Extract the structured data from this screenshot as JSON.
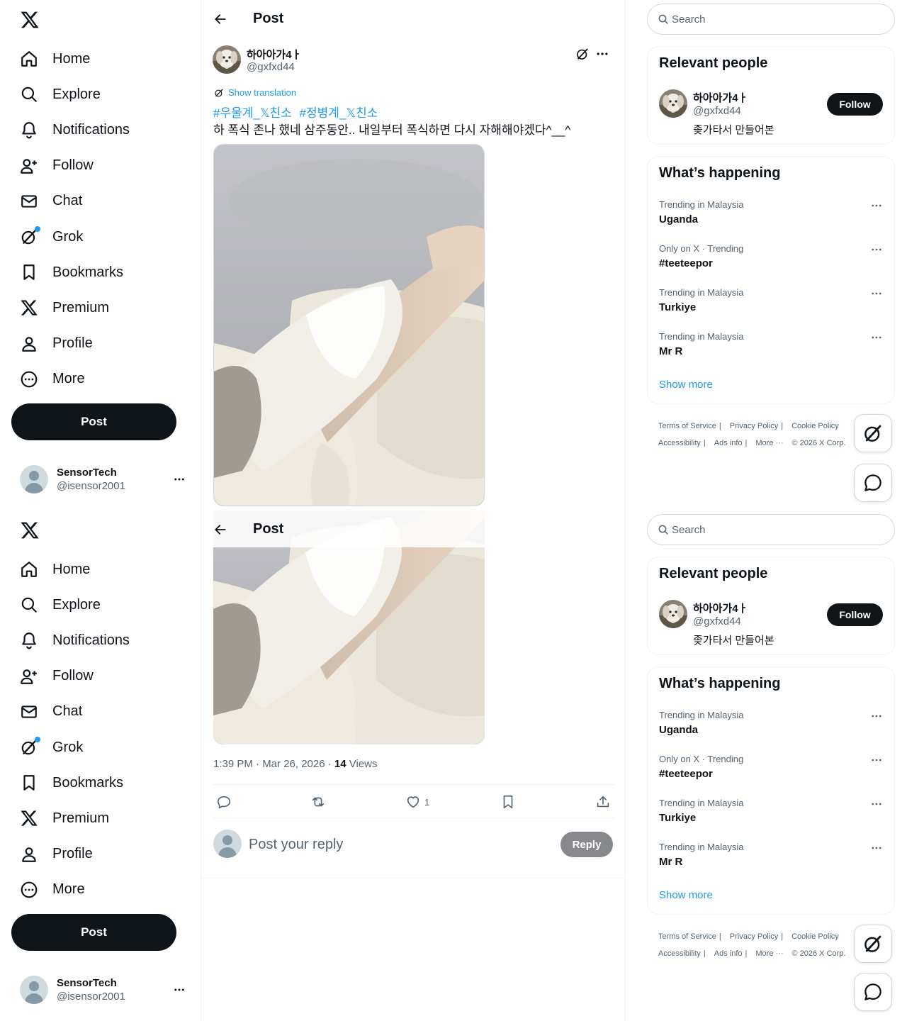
{
  "nav": {
    "items": [
      {
        "label": "Home",
        "icon": "home-icon"
      },
      {
        "label": "Explore",
        "icon": "search-icon"
      },
      {
        "label": "Notifications",
        "icon": "bell-icon"
      },
      {
        "label": "Follow",
        "icon": "person-add-icon"
      },
      {
        "label": "Chat",
        "icon": "envelope-icon"
      },
      {
        "label": "Grok",
        "icon": "grok-icon"
      },
      {
        "label": "Bookmarks",
        "icon": "bookmark-icon"
      },
      {
        "label": "Premium",
        "icon": "x-logo-icon"
      },
      {
        "label": "Profile",
        "icon": "person-icon"
      },
      {
        "label": "More",
        "icon": "more-circle-icon"
      }
    ],
    "post_label": "Post"
  },
  "account": {
    "name": "SensorTech",
    "handle": "@isensor2001"
  },
  "header": {
    "title": "Post"
  },
  "post": {
    "author_name": "하아아가4ㅏ",
    "author_handle": "@gxfxd44",
    "show_translation": "Show translation",
    "hashtags": [
      "#우울계_𝕏친소",
      "#정병계_𝕏친소"
    ],
    "text": "하 폭식 존나 했네 삼주동안.. 내일부터 폭식하면 다시 자해해야겠다^__^",
    "time": "1:39 PM · Mar 26, 2026 · ",
    "views_count": "14",
    "views_label": " Views",
    "likes": "1"
  },
  "reply": {
    "placeholder": "Post your reply",
    "button": "Reply"
  },
  "search": {
    "placeholder": "Search"
  },
  "relevant": {
    "title": "Relevant people",
    "name": "하아아가4ㅏ",
    "handle": "@gxfxd44",
    "bio": "좆가타서 만들어본",
    "follow": "Follow"
  },
  "happening": {
    "title": "What’s happening",
    "trends": [
      {
        "meta": "Trending in Malaysia",
        "name": "Uganda"
      },
      {
        "meta": "Only on X · Trending",
        "name": "#teeteepor"
      },
      {
        "meta": "Trending in Malaysia",
        "name": "Turkiye"
      },
      {
        "meta": "Trending in Malaysia",
        "name": "Mr R"
      }
    ],
    "show_more": "Show more"
  },
  "footer": {
    "terms": "Terms of Service",
    "privacy": "Privacy Policy",
    "cookie": "Cookie Policy",
    "accessibility": "Accessibility",
    "ads": "Ads info",
    "more": "More ···",
    "copyright": "© 2026 X Corp."
  },
  "colors": {
    "accent": "#1d9bf0",
    "text": "#0f1419",
    "secondary": "#536471",
    "border": "#eff3f4"
  }
}
